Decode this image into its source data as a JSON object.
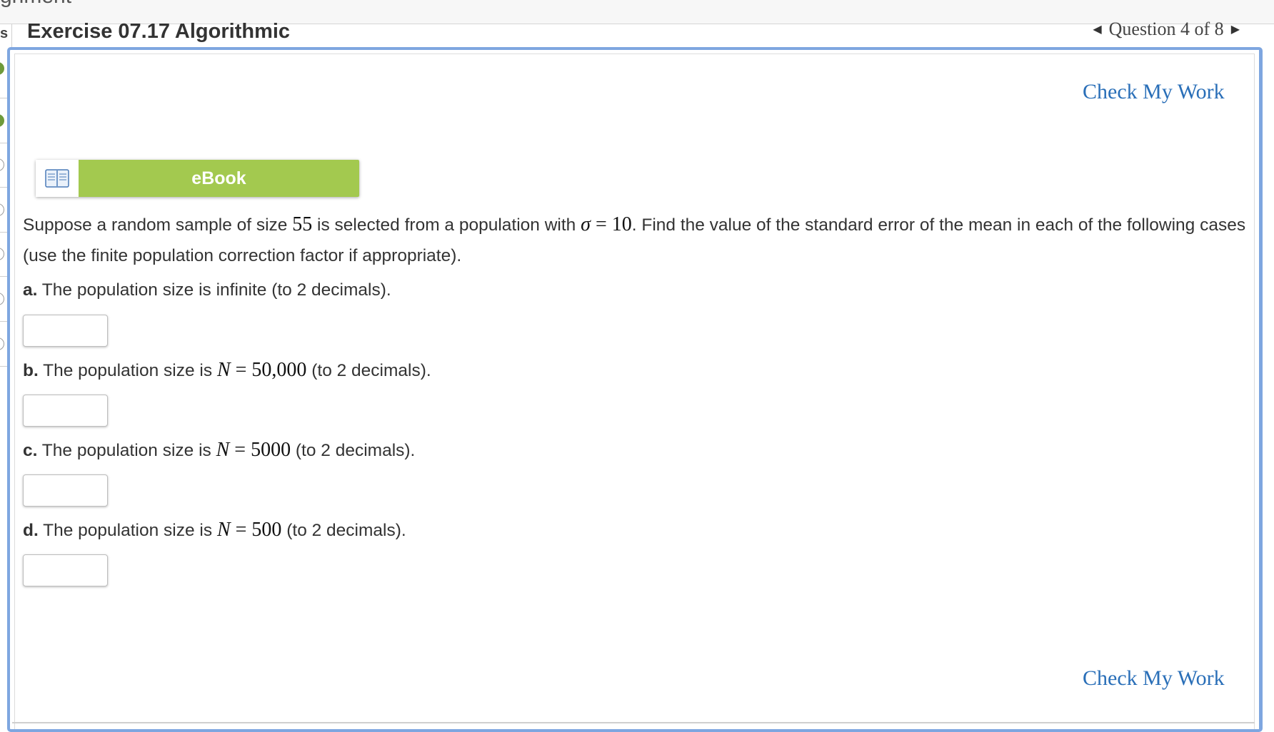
{
  "topbar": {
    "fragment": "gnment"
  },
  "rail": {
    "letter": "s"
  },
  "header": {
    "title": "Exercise 07.17 Algorithmic",
    "question_nav": "Question 4 of 8"
  },
  "actions": {
    "check_my_work_top": "Check My Work",
    "check_my_work_bottom": "Check My Work"
  },
  "ebook": {
    "label": "eBook",
    "icon": "book-icon"
  },
  "question": {
    "intro_1": "Suppose a random sample of size ",
    "sample_size": "55",
    "intro_2": " is selected from a population with ",
    "sigma_symbol": "σ",
    "equals": " = ",
    "sigma_value": "10",
    "intro_3": ". Find the value of the standard error of the mean in each of the following cases (use the finite population correction factor if appropriate)."
  },
  "parts": [
    {
      "letter": "a.",
      "text_before": " The population size is infinite (to 2 decimals).",
      "math_var": "",
      "math_eq": "",
      "math_value": "",
      "text_after": "",
      "answer": ""
    },
    {
      "letter": "b.",
      "text_before": " The population size is ",
      "math_var": "N",
      "math_eq": " = ",
      "math_value": "50,000",
      "text_after": " (to 2 decimals).",
      "answer": ""
    },
    {
      "letter": "c.",
      "text_before": " The population size is ",
      "math_var": "N",
      "math_eq": " = ",
      "math_value": "5000",
      "text_after": " (to 2 decimals).",
      "answer": ""
    },
    {
      "letter": "d.",
      "text_before": " The population size is ",
      "math_var": "N",
      "math_eq": " = ",
      "math_value": "500",
      "text_after": " (to 2 decimals).",
      "answer": ""
    }
  ],
  "colors": {
    "accent_link": "#2a6fb8",
    "ebook_green": "#a3c94f",
    "frame_blue": "#7ea6e0",
    "status_done": "#6e9a3a"
  }
}
